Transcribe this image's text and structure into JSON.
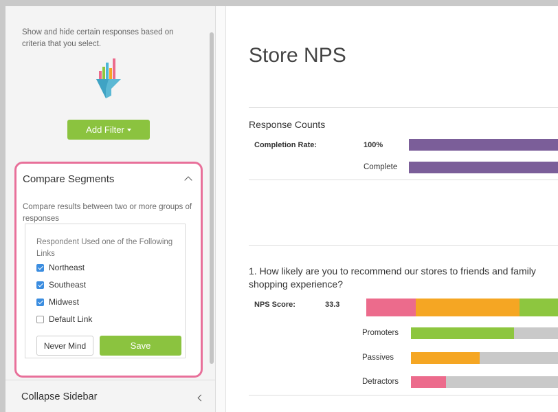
{
  "sidebar": {
    "filter_description": "Show and hide certain responses based on criteria that you select.",
    "add_filter_label": "Add Filter",
    "compare": {
      "title": "Compare Segments",
      "description": "Compare results between two or more groups of responses",
      "links_title": "Respondent Used one of the Following Links",
      "options": [
        {
          "label": "Northeast",
          "checked": true
        },
        {
          "label": "Southeast",
          "checked": true
        },
        {
          "label": "Midwest",
          "checked": true
        },
        {
          "label": "Default Link",
          "checked": false
        }
      ],
      "never_mind_label": "Never Mind",
      "save_label": "Save"
    },
    "collapse_label": "Collapse Sidebar"
  },
  "main": {
    "title": "Store NPS",
    "response_counts": {
      "title": "Response Counts",
      "completion_label": "Completion Rate:",
      "completion_value": "100%",
      "complete_label": "Complete",
      "completion_fraction": 1.0
    },
    "question": {
      "text_line1": "1. How likely are you to recommend our stores to friends and family",
      "text_line2": "shopping experience?",
      "nps_label": "NPS Score:",
      "nps_value": "33.3",
      "rows": [
        {
          "label": "Promoters"
        },
        {
          "label": "Passives"
        },
        {
          "label": "Detractors"
        }
      ]
    }
  },
  "colors": {
    "accent_green": "#8bc33f",
    "highlight_pink": "#e8709a",
    "complete_purple": "#7b5e99",
    "promoter_green": "#8dc63f",
    "passive_orange": "#f5a623",
    "detractor_pink": "#ec6b8c",
    "bar_gray": "#c9c9c9"
  }
}
